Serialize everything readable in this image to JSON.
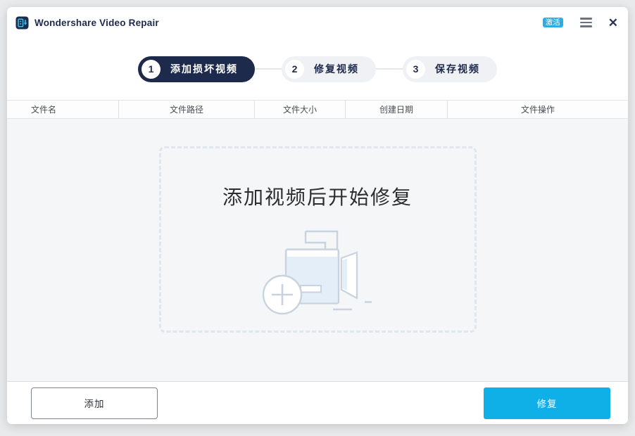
{
  "window": {
    "title": "Wondershare Video Repair"
  },
  "titlebar": {
    "badge": "激活",
    "close_glyph": "✕"
  },
  "steps": [
    {
      "num": "1",
      "label": "添加损坏视频",
      "active": true
    },
    {
      "num": "2",
      "label": "修复视频",
      "active": false
    },
    {
      "num": "3",
      "label": "保存视频",
      "active": false
    }
  ],
  "table": {
    "columns": [
      "文件名",
      "文件路径",
      "文件大小",
      "创建日期",
      "文件操作"
    ],
    "rows": []
  },
  "dropzone": {
    "hint": "添加视频后开始修复"
  },
  "footer": {
    "add_label": "添加",
    "repair_label": "修复"
  },
  "colors": {
    "accent_cyan": "#0fb0e8",
    "badge_cyan": "#2bace2",
    "navy": "#1e2a4c",
    "content_bg": "#f5f6f8",
    "dash_border": "#dfe6ee",
    "icon_stroke": "#c9d3de",
    "icon_fill": "#e3eef8"
  }
}
